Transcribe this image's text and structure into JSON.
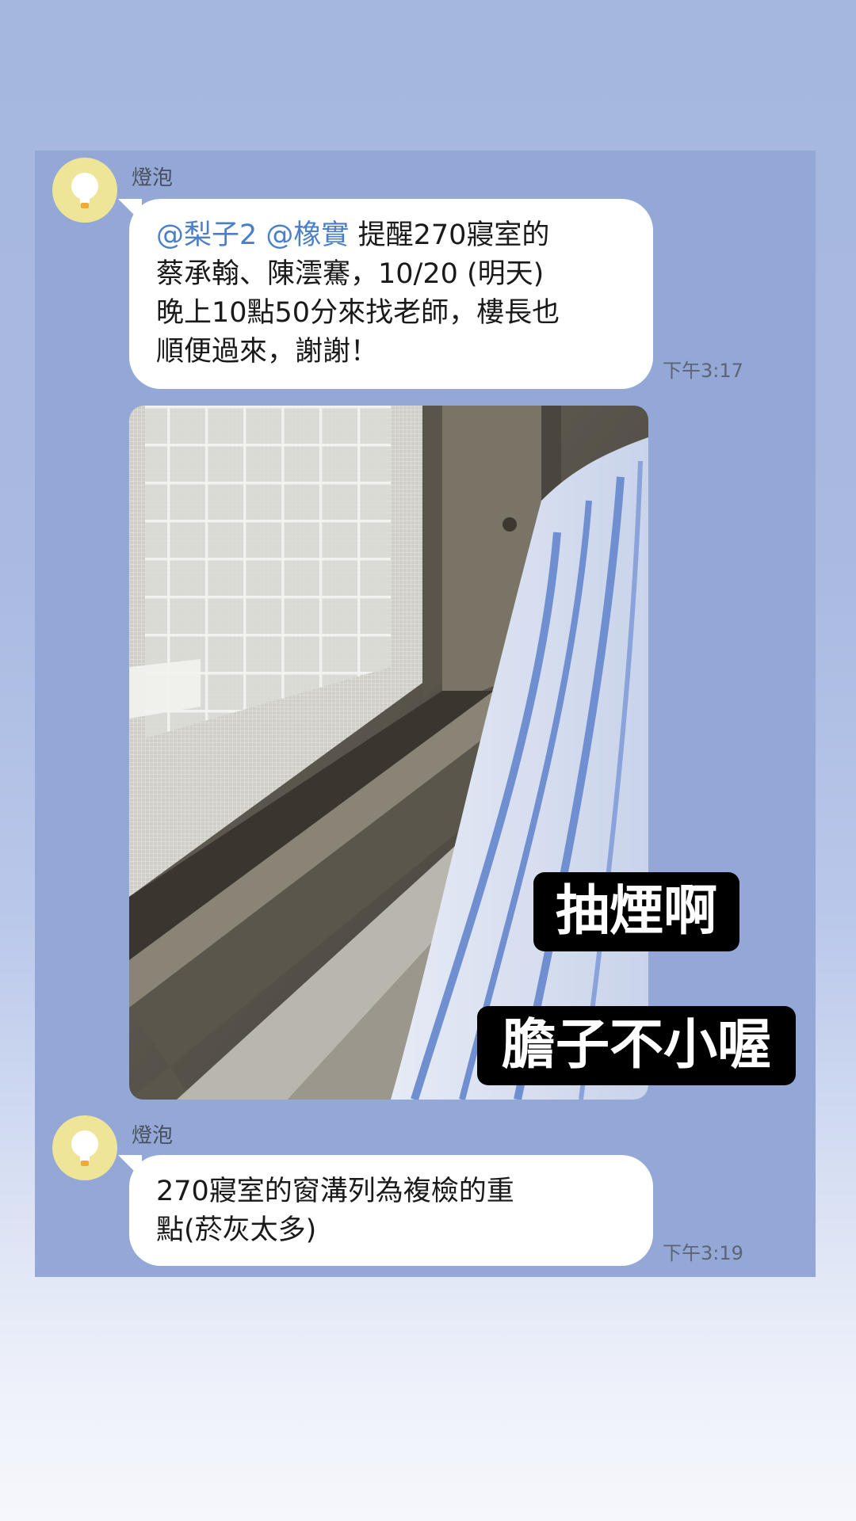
{
  "messages": [
    {
      "sender": "燈泡",
      "mentions": [
        "@梨子2",
        "@橡實"
      ],
      "lines": [
        "提醒270寢室的",
        "蔡承翰、陳澐騫，10/20 (明天)",
        "晚上10點50分來找老師，樓長也",
        "順便過來，謝謝！"
      ],
      "time": "下午3:17"
    },
    {
      "type": "image",
      "description_icon": "window-photo"
    },
    {
      "sender": "燈泡",
      "lines": [
        "270寢室的窗溝列為複檢的重",
        "點(菸灰太多)"
      ],
      "time": "下午3:19"
    }
  ],
  "stickers": {
    "caption_1": "抽煙啊",
    "caption_2": "膽子不小喔"
  },
  "colors": {
    "chat_background": "#93a8d6",
    "bubble": "#ffffff",
    "mention": "#4b7fc9",
    "avatar": "#eee598"
  }
}
